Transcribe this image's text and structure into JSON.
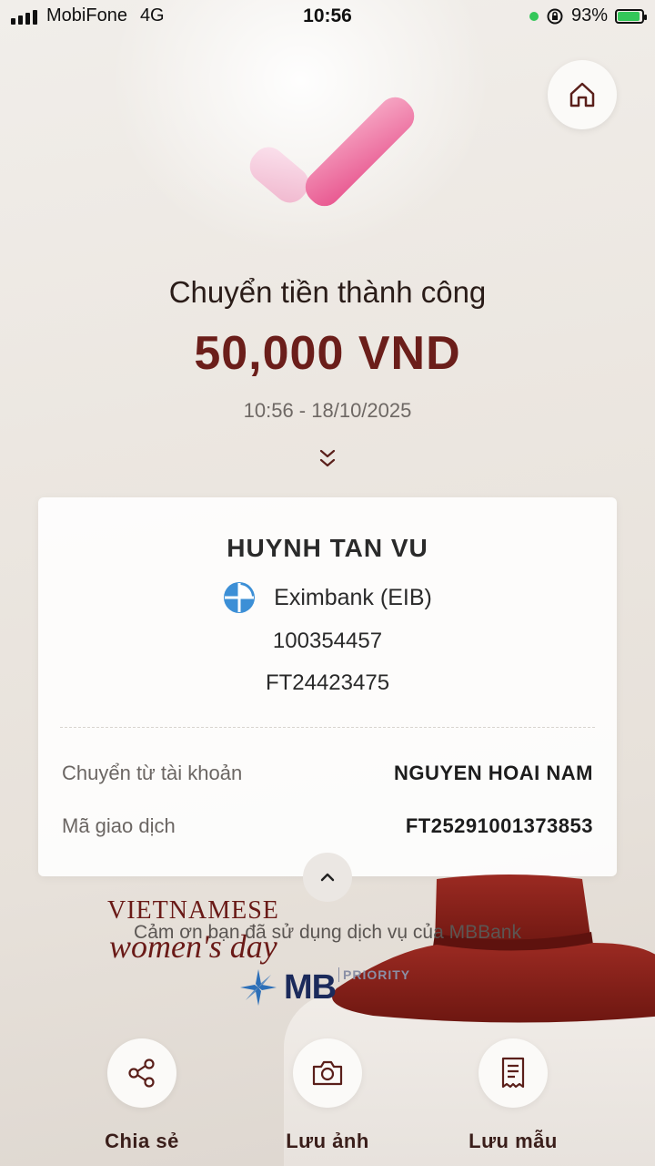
{
  "status_bar": {
    "carrier": "MobiFone",
    "network": "4G",
    "time": "10:56",
    "battery": "93%",
    "battery_level": 0.93
  },
  "result": {
    "title": "Chuyển tiền thành công",
    "amount": "50,000 VND",
    "datetime": "10:56 - 18/10/2025"
  },
  "recipient": {
    "name": "HUYNH TAN VU",
    "bank": "Eximbank (EIB)",
    "account": "100354457",
    "reference": "FT24423475"
  },
  "details": [
    {
      "label": "Chuyển từ tài khoản",
      "value": "NGUYEN HOAI NAM"
    },
    {
      "label": "Mã giao dịch",
      "value": "FT25291001373853"
    }
  ],
  "banner": {
    "line1": "VIETNAMESE",
    "line2": "women's day",
    "thanks": "Cảm ơn bạn đã sử dụng dịch vụ của MBBank",
    "brand": "MB",
    "tier": "PRIORITY"
  },
  "actions": [
    {
      "label": "Chia sẻ",
      "icon": "share-icon"
    },
    {
      "label": "Lưu ảnh",
      "icon": "camera-icon"
    },
    {
      "label": "Lưu mẫu",
      "icon": "receipt-icon"
    }
  ],
  "colors": {
    "accent": "#6b1e1a",
    "check_pink": "#e8568f"
  }
}
